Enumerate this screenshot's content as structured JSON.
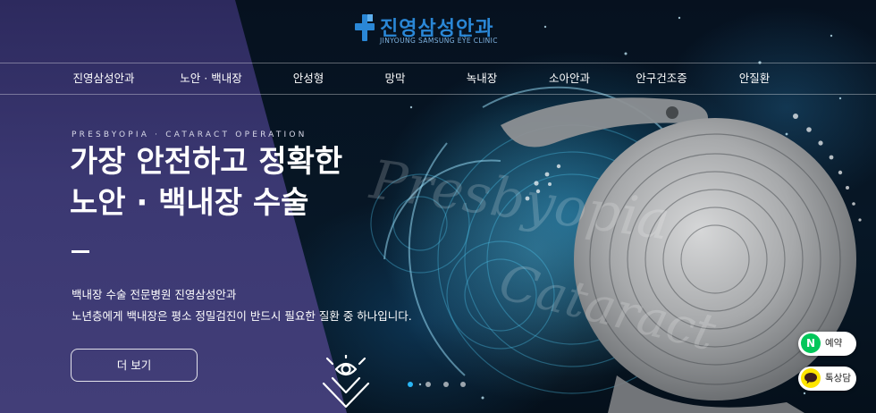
{
  "header": {
    "logo_text": "진영삼성안과",
    "logo_subtext": "JINYOUNG SAMSUNG EYE CLINIC"
  },
  "nav": {
    "items": [
      {
        "label": "진영삼성안과"
      },
      {
        "label": "노안 · 백내장"
      },
      {
        "label": "안성형"
      },
      {
        "label": "망막"
      },
      {
        "label": "녹내장"
      },
      {
        "label": "소아안과"
      },
      {
        "label": "안구건조증"
      },
      {
        "label": "안질환"
      }
    ]
  },
  "hero": {
    "eyebrow": "PRESBYOPIA · CATARACT OPERATION",
    "headline_line1": "가장 안전하고 정확한",
    "headline_line2": "노안 · 백내장 수술",
    "description_line1": "백내장 수술 전문병원 진영삼성안과",
    "description_line2": "노년층에게 백내장은 평소 정밀검진이 반드시 필요한 질환 중 하나입니다.",
    "more_button": "더 보기",
    "script_word1": "Presbyopia",
    "script_word2": "Cataract"
  },
  "slider": {
    "dots": [
      {
        "active": true
      },
      {
        "active": false
      },
      {
        "active": false
      },
      {
        "active": false
      }
    ]
  },
  "floating": {
    "reserve_label": "예약",
    "reserve_icon": "N",
    "kakao_label": "톡상담"
  },
  "colors": {
    "brand_blue": "#2a87d6",
    "panel_purple": "#3b3872",
    "naver_green": "#03c75a",
    "kakao_yellow": "#fee500",
    "active_dot": "#29b6f6"
  }
}
